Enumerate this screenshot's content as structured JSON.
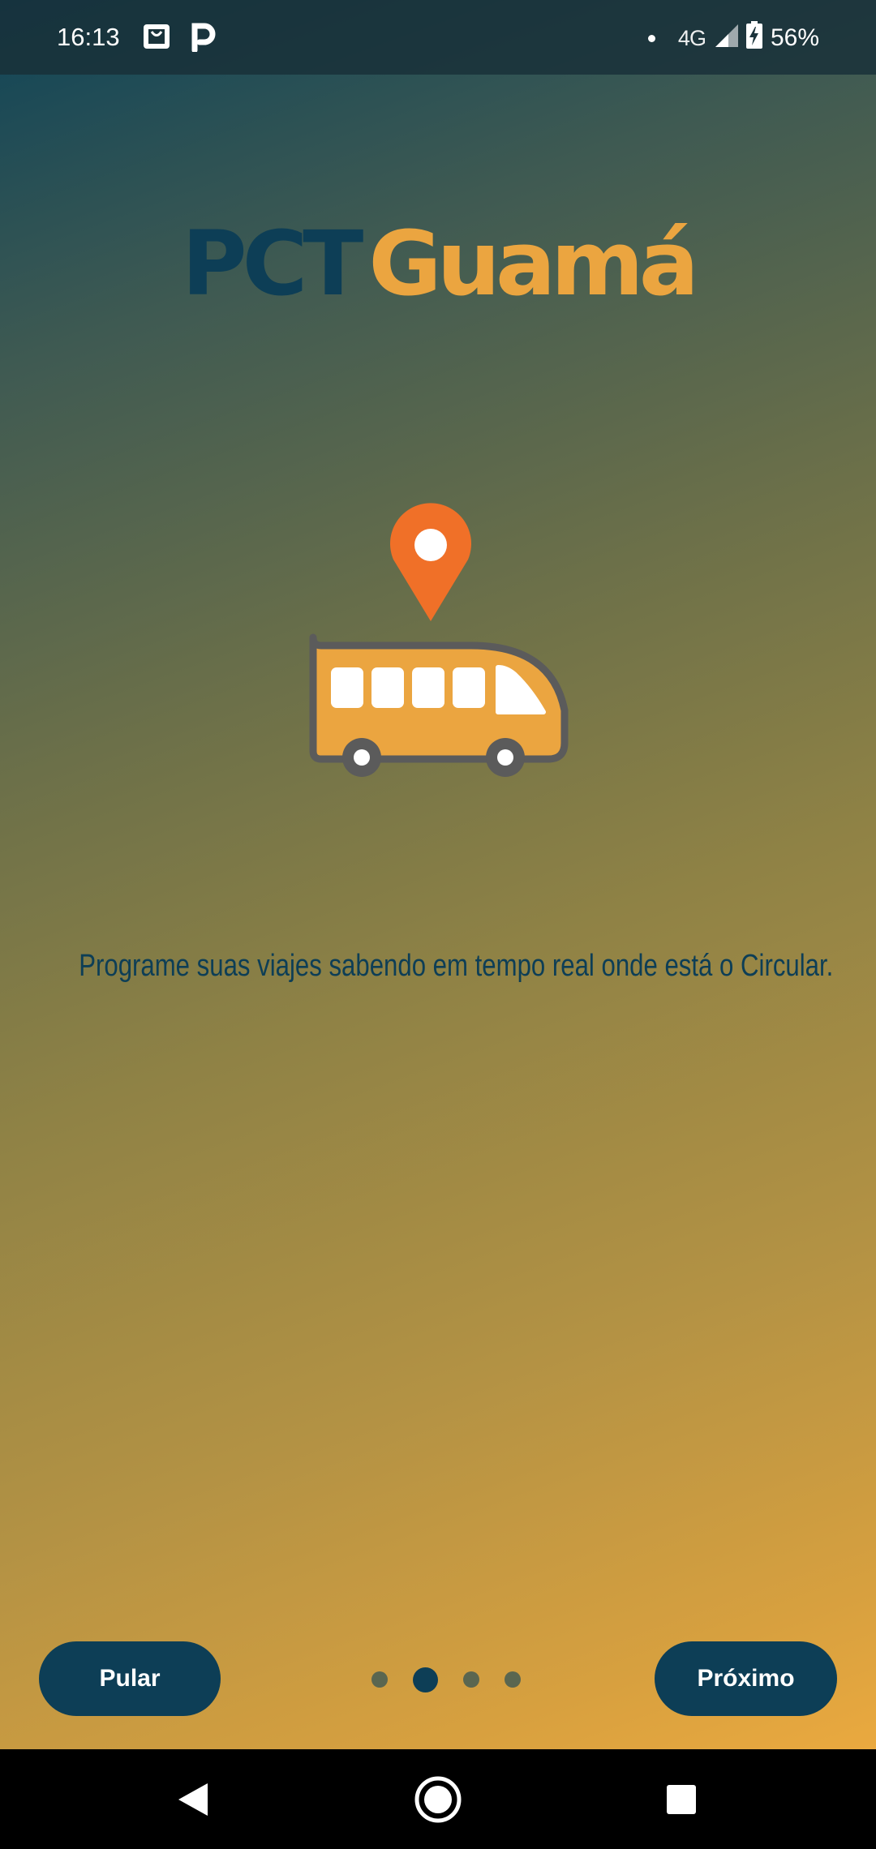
{
  "status_bar": {
    "time": "16:13",
    "network": "4G",
    "battery": "56%"
  },
  "logo": {
    "part1": "PCT",
    "part2": "Guamá"
  },
  "description": "Programe suas viajes sabendo em tempo real onde está o Circular.",
  "buttons": {
    "skip": "Pular",
    "next": "Próximo"
  },
  "pagination": {
    "pages": 4,
    "current_index": 1
  },
  "colors": {
    "primary": "#0d3e56",
    "accent": "#eba540",
    "pin": "#f07028"
  }
}
